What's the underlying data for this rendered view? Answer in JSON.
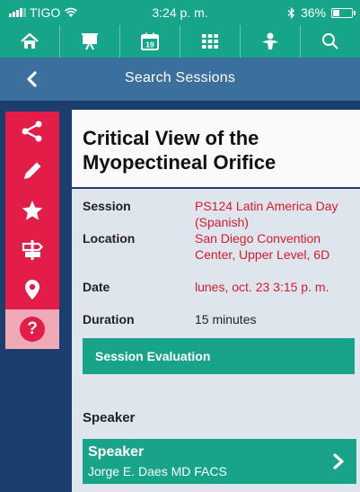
{
  "status": {
    "carrier": "TIGO",
    "time": "3:24 p. m.",
    "battery": "36%",
    "battery_level": 0.36
  },
  "nav": {
    "items": [
      "home-icon",
      "presentation-icon",
      "calendar-icon",
      "grid-icon",
      "person-icon",
      "search-icon"
    ],
    "calendar_day": "19"
  },
  "header": {
    "title": "Search Sessions"
  },
  "sidebar": {
    "items": [
      "share-icon",
      "pencil-icon",
      "star-icon",
      "signpost-icon",
      "location-pin-icon",
      "help-icon"
    ],
    "help_glyph": "?"
  },
  "session": {
    "title": "Critical View of the Myopectineal Orifice",
    "rows": [
      {
        "label": "Session",
        "value": "PS124 Latin America Day (Spanish)"
      },
      {
        "label": "Location",
        "value": "San Diego Convention Center, Upper Level, 6D"
      },
      {
        "label": "Date",
        "value": "lunes, oct. 23 3:15 p. m."
      },
      {
        "label": "Duration",
        "value": "15 minutes"
      }
    ],
    "evaluation_label": "Session Evaluation"
  },
  "speaker": {
    "heading": "Speaker",
    "label": "Speaker",
    "name": "Jorge E. Daes MD FACS"
  },
  "colors": {
    "teal": "#17a58a",
    "title_bar": "#3b6f9e",
    "navy": "#1b3e6e",
    "sidebar_red": "#e11d48",
    "value_red": "#d81b2e"
  }
}
